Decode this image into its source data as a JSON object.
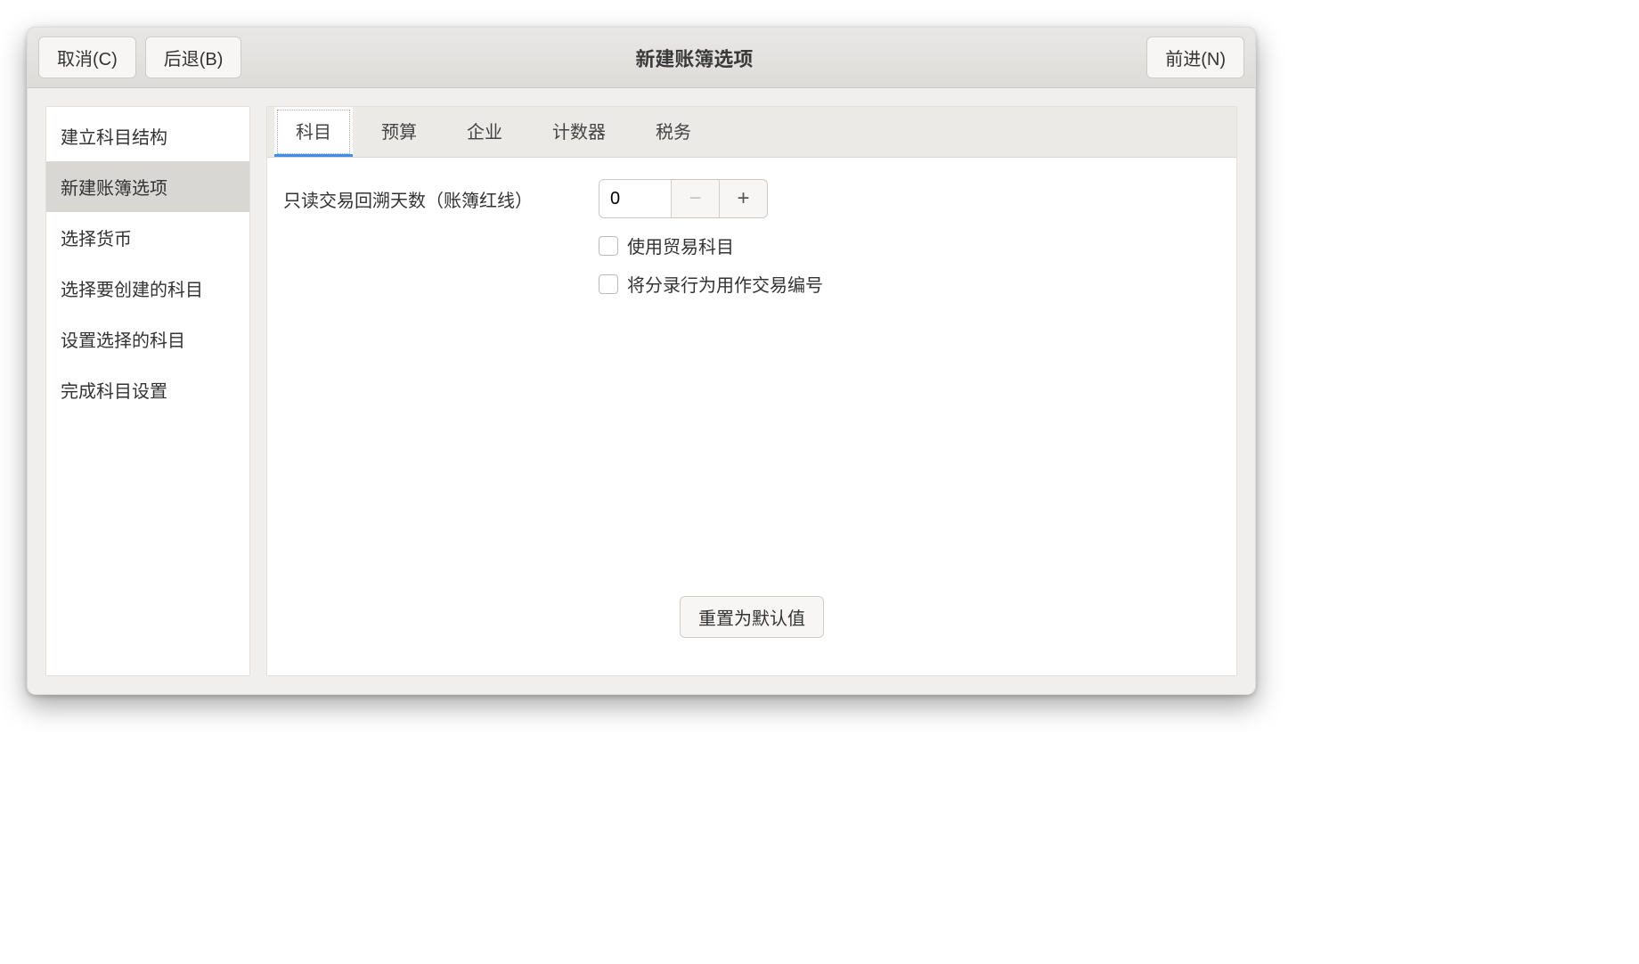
{
  "window": {
    "title": "新建账簿选项",
    "cancel_label": "取消(C)",
    "back_label": "后退(B)",
    "forward_label": "前进(N)"
  },
  "sidebar": {
    "items": [
      {
        "label": "建立科目结构",
        "active": false
      },
      {
        "label": "新建账簿选项",
        "active": true
      },
      {
        "label": "选择货币",
        "active": false
      },
      {
        "label": "选择要创建的科目",
        "active": false
      },
      {
        "label": "设置选择的科目",
        "active": false
      },
      {
        "label": "完成科目设置",
        "active": false
      }
    ]
  },
  "tabs": [
    {
      "label": "科目",
      "active": true
    },
    {
      "label": "预算",
      "active": false
    },
    {
      "label": "企业",
      "active": false
    },
    {
      "label": "计数器",
      "active": false
    },
    {
      "label": "税务",
      "active": false
    }
  ],
  "form": {
    "readonly_days_label": "只读交易回溯天数（账簿红线）",
    "readonly_days_value": "0",
    "minus_glyph": "−",
    "plus_glyph": "+",
    "checkbox1_label": "使用贸易科目",
    "checkbox2_label": "将分录行为用作交易编号",
    "reset_label": "重置为默认值"
  }
}
